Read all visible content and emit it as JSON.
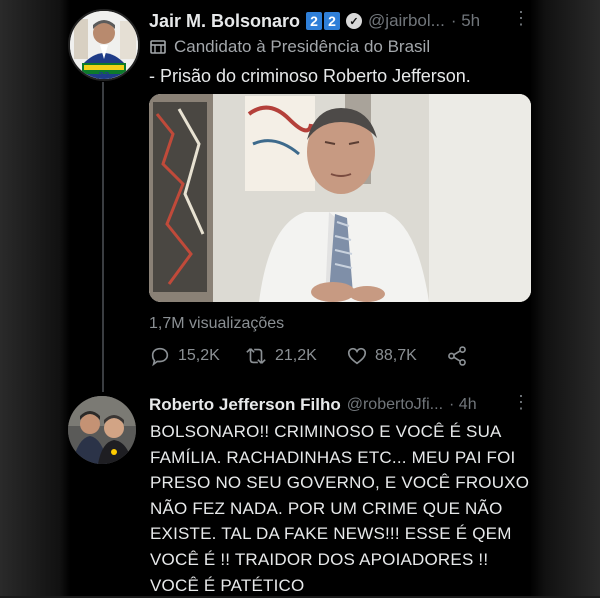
{
  "tweet": {
    "author_name": "Jair M. Bolsonaro",
    "badge_digits": [
      "2",
      "2"
    ],
    "handle": "@jairbol...",
    "time": "· 5h",
    "label": "Candidato à Presidência do Brasil",
    "text": "- Prisão do criminoso Roberto Jefferson.",
    "views": "1,7M visualizações",
    "replies": "15,2K",
    "retweets": "21,2K",
    "likes": "88,7K"
  },
  "reply": {
    "author_name": "Roberto Jefferson Filho",
    "handle": "@robertoJfi...",
    "time": "· 4h",
    "text": "BOLSONARO!! CRIMINOSO E VOCÊ É SUA FAMÍLIA. RACHADINHAS ETC... MEU PAI FOI PRESO NO SEU GOVERNO, E VOCÊ FROUXO NÃO FEZ NADA. POR UM CRIME QUE NÃO EXISTE. TAL DA FAKE NEWS!!! ESSE É QEM VOCÊ É !! TRAIDOR DOS APOIADORES !! VOCÊ É PATÉTICO"
  },
  "colors": {
    "background": "#000000",
    "text": "#e7e9ea",
    "muted": "#71767b",
    "badge": "#2f7fd8"
  },
  "icons": [
    "reply-icon",
    "retweet-icon",
    "like-icon",
    "share-icon",
    "verified-icon",
    "government-label-icon",
    "more-icon"
  ]
}
